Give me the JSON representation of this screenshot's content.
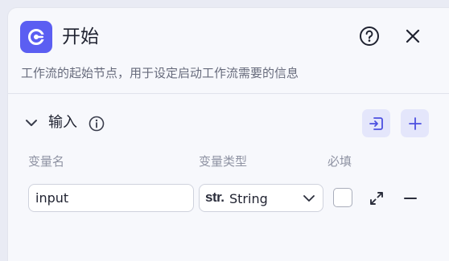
{
  "node": {
    "title": "开始",
    "description": "工作流的起始节点，用于设定启动工作流需要的信息",
    "icon": "start-node-icon",
    "accent_color": "#5b5ef2"
  },
  "header_actions": {
    "help_icon": "question-circle-icon",
    "close_icon": "close-icon"
  },
  "input_section": {
    "title": "输入",
    "info_icon": "info-circle-icon",
    "import_icon": "import-variables-icon",
    "add_icon": "plus-icon"
  },
  "table": {
    "columns": [
      "变量名",
      "变量类型",
      "必填"
    ],
    "rows": [
      {
        "name": "input",
        "type_prefix": "str.",
        "type": "String",
        "required": false
      }
    ]
  }
}
